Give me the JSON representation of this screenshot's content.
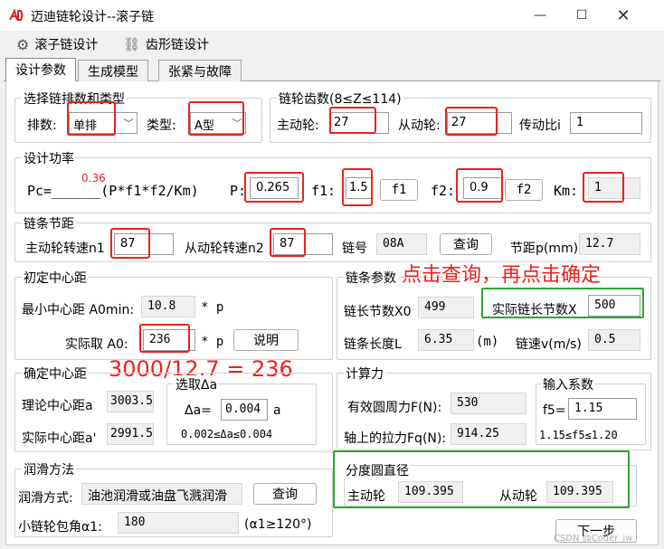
{
  "window": {
    "title": "迈迪链轮设计--滚子链",
    "logo": "AD"
  },
  "menu": {
    "items": [
      {
        "label": "滚子链设计",
        "icon": "gear-icon"
      },
      {
        "label": "齿形链设计",
        "icon": "chain-icon"
      }
    ]
  },
  "tabs": [
    "设计参数",
    "生成模型",
    "张紧与故障"
  ],
  "chain_type": {
    "title": "选择链排数和类型",
    "rows_label": "排数:",
    "rows_value": "单排",
    "type_label": "类型:",
    "type_value": "A型"
  },
  "teeth": {
    "title": "链轮齿数(8≤Z≤114)",
    "driver_label": "主动轮:",
    "driver_value": "27",
    "driven_label": "从动轮:",
    "driven_value": "27",
    "ratio_label": "传动比i",
    "ratio_value": "1"
  },
  "power": {
    "title": "设计功率",
    "pc_value": "0.36",
    "formula": "Pc=______(P*f1*f2/Km)",
    "p_label": "P:",
    "p_value": "0.265",
    "f1_label": "f1:",
    "f1_value": "1.5",
    "f1_button": "f1",
    "f2_label": "f2:",
    "f2_value": "0.9",
    "f2_button": "f2",
    "km_label": "Km:",
    "km_value": "1"
  },
  "pitch": {
    "title": "链条节距",
    "n1_label": "主动轮转速n1",
    "n1_value": "87",
    "n2_label": "从动轮转速n2",
    "n2_value": "87",
    "chain_no_label": "链号",
    "chain_no_value": "08A",
    "query_button": "查询",
    "pitch_label": "节距p(mm)",
    "pitch_value": "12.7"
  },
  "initial_center": {
    "title": "初定中心距",
    "min_label": "最小中心距 A0min:",
    "min_value": "10.8",
    "min_unit": "* p",
    "actual_label": "实际取 A0:",
    "actual_value": "236",
    "actual_unit": "* p",
    "explain_button": "说明"
  },
  "chain_params": {
    "title": "链条参数",
    "links_label": "链长节数X0",
    "links_value": "499",
    "actual_links_label": "实际链长节数X",
    "actual_links_value": "500",
    "length_label": "链条长度L",
    "length_value": "6.35",
    "length_unit": "(m)",
    "speed_label": "链速v(m/s)",
    "speed_value": "0.5"
  },
  "annotations": {
    "query_note": "点击查询，再点击确定",
    "calc_note": "3000/12.7 = 236"
  },
  "final_center": {
    "title": "确定中心距",
    "theory_label": "理论中心距a",
    "theory_value": "3003.5",
    "actual_label": "实际中心距a'",
    "actual_value": "2991.5",
    "delta_title": "选取Δa",
    "delta_label": "Δa=",
    "delta_value": "0.004",
    "delta_unit": "a",
    "delta_range": "0.002≤Δa≤0.004"
  },
  "calc": {
    "title": "计算力",
    "force_label": "有效圆周力F(N):",
    "force_value": "530",
    "pull_label": "轴上的拉力Fq(N):",
    "pull_value": "914.25",
    "coef_title": "输入系数",
    "f5_label": "f5=",
    "f5_value": "1.15",
    "f5_range": "1.15≤f5≤1.20"
  },
  "lubrication": {
    "title": "润滑方法",
    "method_label": "润滑方式:",
    "method_value": "油池润滑或油盘飞溅润滑",
    "query_button": "查询",
    "angle_label": "小链轮包角α1:",
    "angle_value": "180",
    "angle_note": "(α1≥120°)"
  },
  "pitch_circle": {
    "title": "分度圆直径",
    "driver_label": "主动轮",
    "driver_value": "109.395",
    "driven_label": "从动轮",
    "driven_value": "109.395"
  },
  "footer": {
    "next_button": "下一步",
    "watermark": "CSDN @Coder_jw"
  }
}
